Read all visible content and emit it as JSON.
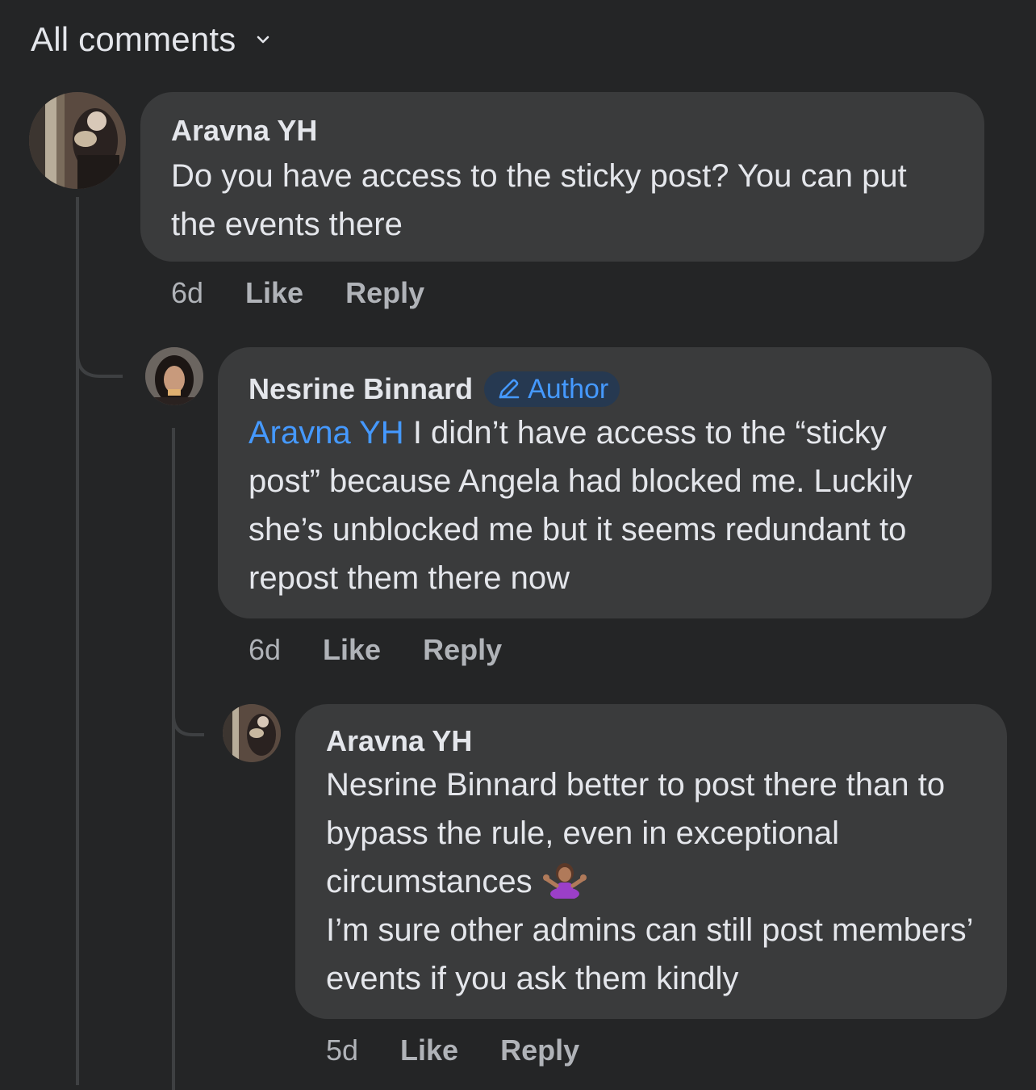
{
  "header": {
    "title": "All comments",
    "chevron_icon": "chevron-down-icon"
  },
  "comments": [
    {
      "author": "Aravna YH",
      "text": "Do you have access to the sticky post? You can put the events there",
      "time": "6d",
      "like": "Like",
      "reply": "Reply"
    },
    {
      "author": "Nesrine Binnard",
      "badge": "Author",
      "badge_icon": "pencil-icon",
      "mention": "Aravna YH",
      "text": "I didn’t have access to the “sticky post” because Angela had blocked me. Luckily she’s unblocked me but it seems redundant to repost them there now",
      "time": "6d",
      "like": "Like",
      "reply": "Reply"
    },
    {
      "author": "Aravna YH",
      "line1": "Nesrine Binnard better to post there than to bypass the rule, even in exceptional circumstances",
      "emoji": "person-shrugging-emoji",
      "line2": "I’m sure other admins can still post members’ events if you ask them kindly",
      "time": "5d",
      "like": "Like",
      "reply": "Reply"
    }
  ],
  "colors": {
    "background": "#242526",
    "bubble": "#3a3b3c",
    "text": "#e4e6eb",
    "secondary_text": "#b0b3b8",
    "mention": "#4599ff",
    "badge_bg": "#263951"
  }
}
